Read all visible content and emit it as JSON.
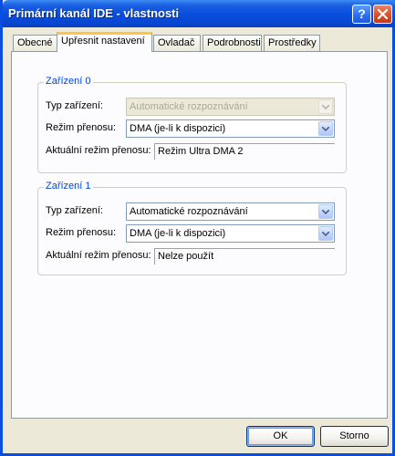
{
  "window": {
    "title": "Primární kanál IDE - vlastnosti",
    "help_label": "?"
  },
  "tabs": [
    {
      "label": "Obecné",
      "active": false
    },
    {
      "label": "Upřesnit nastavení",
      "active": true
    },
    {
      "label": "Ovladač",
      "active": false
    },
    {
      "label": "Podrobnosti",
      "active": false
    },
    {
      "label": "Prostředky",
      "active": false
    }
  ],
  "device0": {
    "legend": "Zařízení 0",
    "type_label": "Typ zařízení:",
    "type_value": "Automatické rozpoznávání",
    "type_enabled": false,
    "mode_label": "Režim přenosu:",
    "mode_value": "DMA (je-li k dispozici)",
    "current_label": "Aktuální režim přenosu:",
    "current_value": "Režim Ultra DMA 2"
  },
  "device1": {
    "legend": "Zařízení 1",
    "type_label": "Typ zařízení:",
    "type_value": "Automatické rozpoznávání",
    "type_enabled": true,
    "mode_label": "Režim přenosu:",
    "mode_value": "DMA (je-li k dispozici)",
    "current_label": "Aktuální režim přenosu:",
    "current_value": "Nelze použít"
  },
  "buttons": {
    "ok_label": "OK",
    "cancel_label": "Storno"
  },
  "colors": {
    "titlebar": "#0a4ee0",
    "group_legend": "#0046d5",
    "active_tab_accent": "#ffc73c",
    "close_button": "#d8502a"
  }
}
